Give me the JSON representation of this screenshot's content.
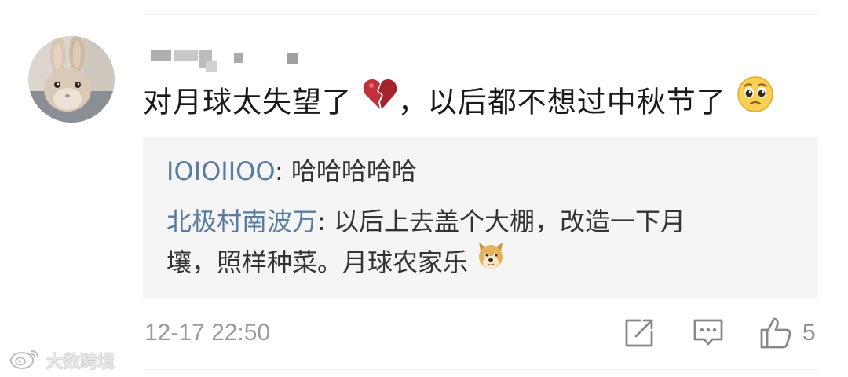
{
  "post": {
    "author": {
      "name_redacted": true,
      "avatar": "rabbit-avatar"
    },
    "comment_text": "对月球太失望了",
    "comment_separator": "，",
    "comment_text_2": "以后都不想过中秋节了",
    "emoji_1": "broken-heart-icon",
    "emoji_2": "pleading-face-icon"
  },
  "replies": [
    {
      "name": "IOIOIIOO",
      "separator": ": ",
      "text": "哈哈哈哈哈"
    },
    {
      "name": "北极村南波万",
      "separator": ": ",
      "text_line1": "以后上去盖个大棚，改造一下月",
      "text_line2": "壤，照样种菜。月球农家乐",
      "emoji": "doge-icon"
    }
  ],
  "footer": {
    "timestamp": "12-17 22:50",
    "like_count": "5",
    "icons": [
      "share-icon",
      "comment-icon",
      "like-icon"
    ]
  },
  "watermark": {
    "text": "大数跨境",
    "icon": "weibo-logo-icon"
  },
  "colors": {
    "reply_name": "#5a7ba0",
    "reply_bg": "#f5f5f5",
    "timestamp": "#9a9a9a",
    "icon_gray": "#888888"
  }
}
